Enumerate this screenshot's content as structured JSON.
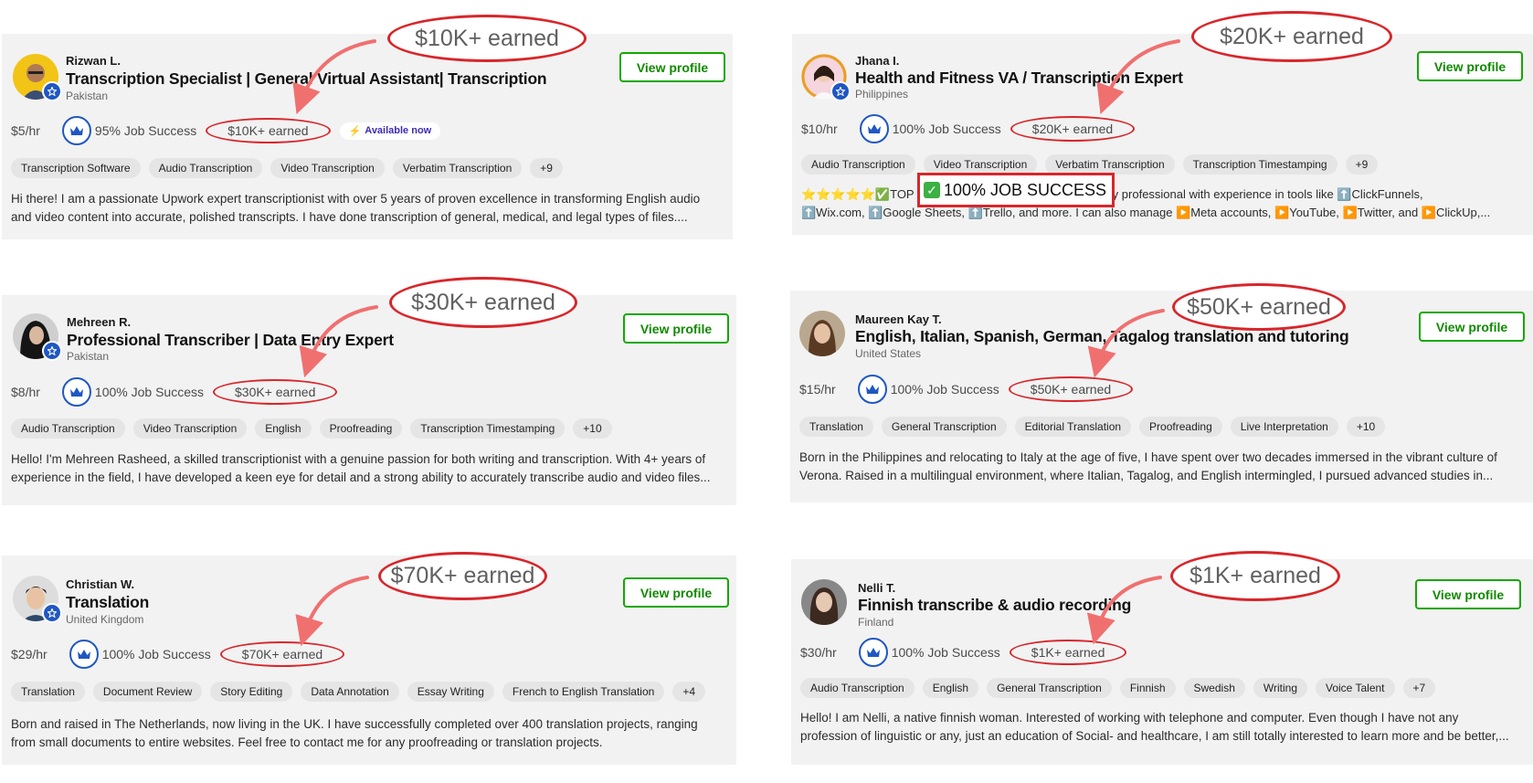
{
  "view_profile_label": "View profile",
  "profiles": [
    {
      "name": "Rizwan L.",
      "title": "Transcription Specialist | General Virtual Assistant| Transcription",
      "country": "Pakistan",
      "rate": "$5/hr",
      "job_success": "95% Job Success",
      "earned": "$10K+ earned",
      "available": "Available now",
      "skills": [
        "Transcription Software",
        "Audio Transcription",
        "Video Transcription",
        "Verbatim Transcription",
        "+9"
      ],
      "description": "Hi there! I am a passionate Upwork expert transcriptionist with over 5 years of proven excellence in transforming English audio\nand video content into accurate, polished transcripts. I have done transcription of general, medical, and legal types of files....",
      "callout": "$10K+ earned"
    },
    {
      "name": "Jhana I.",
      "title": "Health and Fitness VA / Transcription Expert",
      "country": "Philippines",
      "rate": "$10/hr",
      "job_success": "100% Job Success",
      "earned": "$20K+ earned",
      "skills": [
        "Audio Transcription",
        "Video Transcription",
        "Verbatim Transcription",
        "Transcription Timestamping",
        "+9"
      ],
      "description_line1_start": "⭐⭐⭐⭐⭐✅TOP RA",
      "description_line1_end": "tech-savvy professional with experience in tools like ⬆️ClickFunnels,",
      "description_line2": "⬆️Wix.com, ⬆️Google Sheets, ⬆️Trello, and more. I can also manage ▶️Meta accounts, ▶️YouTube, ▶️Twitter, and ▶️ClickUp,...",
      "job_success_box": "100% JOB SUCCESS",
      "callout": "$20K+ earned"
    },
    {
      "name": "Mehreen R.",
      "title": "Professional Transcriber | Data Entry Expert",
      "country": "Pakistan",
      "rate": "$8/hr",
      "job_success": "100% Job Success",
      "earned": "$30K+ earned",
      "skills": [
        "Audio Transcription",
        "Video Transcription",
        "English",
        "Proofreading",
        "Transcription Timestamping",
        "+10"
      ],
      "description": "Hello! I'm Mehreen Rasheed, a skilled transcriptionist with a genuine passion for both writing and transcription. With 4+ years of\nexperience in the field, I have developed a keen eye for detail and a strong ability to accurately transcribe audio and video files...",
      "callout": "$30K+ earned"
    },
    {
      "name": "Maureen Kay T.",
      "title": "English, Italian, Spanish, German, Tagalog translation and tutoring",
      "country": "United States",
      "rate": "$15/hr",
      "job_success": "100% Job Success",
      "earned": "$50K+ earned",
      "skills": [
        "Translation",
        "General Transcription",
        "Editorial Translation",
        "Proofreading",
        "Live Interpretation",
        "+10"
      ],
      "description": "Born in the Philippines and relocating to Italy at the age of five, I have spent over two decades immersed in the vibrant culture of\nVerona. Raised in a multilingual environment, where Italian, Tagalog, and English intermingled, I pursued advanced studies in...",
      "callout": "$50K+ earned"
    },
    {
      "name": "Christian W.",
      "title": "Translation",
      "country": "United Kingdom",
      "rate": "$29/hr",
      "job_success": "100% Job Success",
      "earned": "$70K+ earned",
      "skills": [
        "Translation",
        "Document Review",
        "Story Editing",
        "Data Annotation",
        "Essay Writing",
        "French to English Translation",
        "+4"
      ],
      "description": "Born and raised in The Netherlands, now living in the UK. I have successfully completed over 400 translation projects, ranging\nfrom small documents to entire websites. Feel free to contact me for any proofreading or translation projects.",
      "callout": "$70K+ earned"
    },
    {
      "name": "Nelli T.",
      "title": "Finnish transcribe & audio recording",
      "country": "Finland",
      "rate": "$30/hr",
      "job_success": "100% Job Success",
      "earned": "$1K+ earned",
      "skills": [
        "Audio Transcription",
        "English",
        "General Transcription",
        "Finnish",
        "Swedish",
        "Writing",
        "Voice Talent",
        "+7"
      ],
      "description": "Hello! I am Nelli, a native finnish woman. Interested of working with telephone and computer. Even though I have not any\nprofession of linguistic or any, just an education of Social- and healthcare, I am still totally interested to learn more and be better,...",
      "callout": "$1K+ earned"
    }
  ],
  "colors": {
    "accent_green": "#14a800",
    "annotation_red": "#d8262b",
    "badge_blue": "#1f57c3",
    "card_bg": "#f2f2f2"
  },
  "icons": [
    "verified-star-icon",
    "crown-icon",
    "lightning-bolt-icon",
    "curved-arrow-annotation"
  ]
}
